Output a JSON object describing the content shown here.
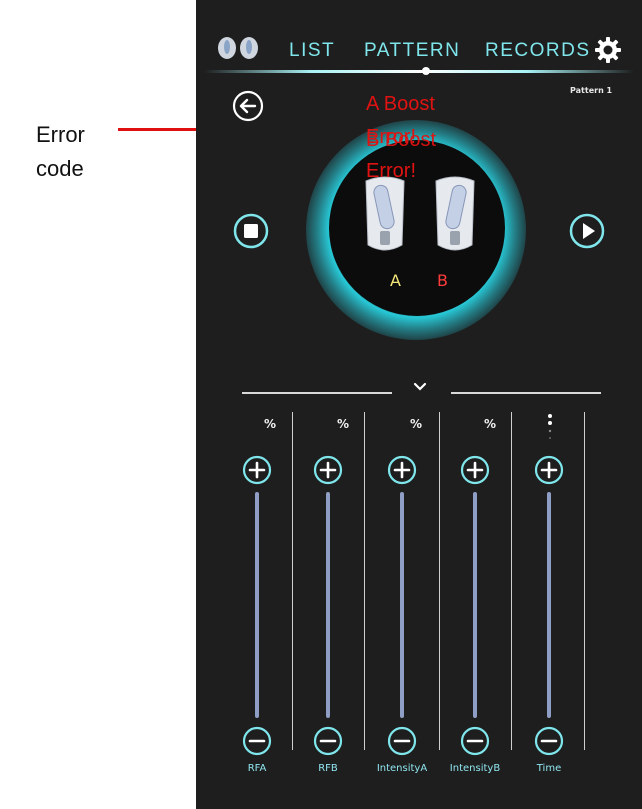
{
  "annotation": {
    "line1": "Error",
    "line2": "code",
    "line_color": "#e01010"
  },
  "nav": {
    "logo_icon": "earbuds-icon",
    "items": [
      {
        "label": "LIST"
      },
      {
        "label": "PATTERN"
      },
      {
        "label": "RECORDS"
      }
    ],
    "settings_icon": "gear-icon",
    "accent": "#7fe6ec"
  },
  "header": {
    "back_icon": "arrow-left-circle-icon",
    "pattern_label": "Pattern 1"
  },
  "errors": {
    "a_boost_error": "A Boost",
    "a_error_word": "Error!",
    "b_boost_error": "B Boost",
    "b_error_word": "Error!",
    "color": "#e01212"
  },
  "device": {
    "label_a": "A",
    "label_b": "B",
    "label_a_color": "#f5e67a",
    "label_b_color": "#ff3b3b"
  },
  "controls": {
    "stop_icon": "stop-circle-icon",
    "play_icon": "play-circle-icon",
    "collapse_icon": "chevron-down-icon"
  },
  "channels": [
    {
      "name": "RFA",
      "unit": "%"
    },
    {
      "name": "RFB",
      "unit": "%"
    },
    {
      "name": "IntensityA",
      "unit": "%"
    },
    {
      "name": "IntensityB",
      "unit": "%"
    },
    {
      "name": "Time",
      "unit": ""
    }
  ]
}
